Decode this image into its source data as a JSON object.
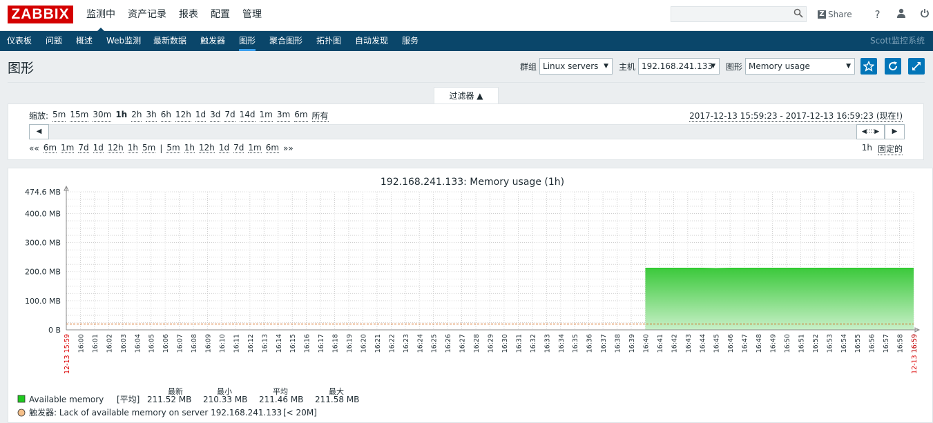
{
  "top": {
    "logo": "ZABBIX",
    "menu": [
      "监测中",
      "资产记录",
      "报表",
      "配置",
      "管理"
    ],
    "share_label": "Share",
    "icons": [
      "search-icon",
      "help-icon",
      "user-icon",
      "power-icon"
    ]
  },
  "nav": {
    "items": [
      "仪表板",
      "问题",
      "概述",
      "Web监测",
      "最新数据",
      "触发器",
      "图形",
      "聚合图形",
      "拓扑图",
      "自动发现",
      "服务"
    ],
    "active": "图形",
    "brand": "Scott监控系统"
  },
  "page": {
    "title": "图形",
    "group_label": "群组",
    "group_value": "Linux servers",
    "host_label": "主机",
    "host_value": "192.168.241.133",
    "graph_label": "图形",
    "graph_value": "Memory usage"
  },
  "filter": {
    "tab_label": "过滤器 ▲",
    "zoom_label": "缩放:",
    "zoom": [
      "5m",
      "15m",
      "30m",
      "1h",
      "2h",
      "3h",
      "6h",
      "12h",
      "1d",
      "3d",
      "7d",
      "14d",
      "1m",
      "3m",
      "6m",
      "所有"
    ],
    "zoom_active": "1h",
    "period": "2017-12-13 15:59:23 - 2017-12-13 16:59:23 (现在!)",
    "back_start": "««",
    "back": [
      "6m",
      "1m",
      "7d",
      "1d",
      "12h",
      "1h",
      "5m"
    ],
    "divider": "|",
    "fwd": [
      "5m",
      "1h",
      "12h",
      "1d",
      "7d",
      "1m",
      "6m"
    ],
    "fwd_end": "»»",
    "fixed_value": "1h",
    "fixed_label": "固定的"
  },
  "chart_data": {
    "type": "area",
    "title": "192.168.241.133: Memory usage (1h)",
    "y_ticks": [
      "0 B",
      "100.0 MB",
      "200.0 MB",
      "300.0 MB",
      "400.0 MB",
      "474.6 MB"
    ],
    "ylim": [
      0,
      474.6
    ],
    "x_start_label": "12-13 15:59",
    "x_end_label": "12-13 16:59",
    "x_ticks": [
      "16:00",
      "16:01",
      "16:02",
      "16:03",
      "16:04",
      "16:05",
      "16:06",
      "16:07",
      "16:08",
      "16:09",
      "16:10",
      "16:11",
      "16:12",
      "16:13",
      "16:14",
      "16:15",
      "16:16",
      "16:17",
      "16:18",
      "16:19",
      "16:20",
      "16:21",
      "16:22",
      "16:23",
      "16:24",
      "16:25",
      "16:26",
      "16:27",
      "16:28",
      "16:29",
      "16:30",
      "16:31",
      "16:32",
      "16:33",
      "16:34",
      "16:35",
      "16:36",
      "16:37",
      "16:38",
      "16:39",
      "16:40",
      "16:41",
      "16:42",
      "16:43",
      "16:44",
      "16:45",
      "16:46",
      "16:47",
      "16:48",
      "16:49",
      "16:50",
      "16:51",
      "16:52",
      "16:53",
      "16:54",
      "16:55",
      "16:56",
      "16:57",
      "16:58",
      "16:59"
    ],
    "series": [
      {
        "name": "Available memory",
        "color": "#1fc91f",
        "x": [
          "16:40",
          "16:41",
          "16:42",
          "16:43",
          "16:44",
          "16:45",
          "16:46",
          "16:47",
          "16:48",
          "16:49",
          "16:50",
          "16:51",
          "16:52",
          "16:53",
          "16:54",
          "16:55",
          "16:56",
          "16:57",
          "16:58",
          "16:59"
        ],
        "values": [
          211.5,
          211.5,
          211.5,
          211.5,
          211.5,
          210.3,
          211.5,
          211.5,
          211.5,
          211.5,
          211.5,
          211.5,
          211.5,
          211.5,
          211.5,
          211.5,
          211.5,
          211.5,
          211.5,
          211.6
        ]
      }
    ],
    "threshold": {
      "value": 20,
      "color": "#d2691e"
    },
    "legend": {
      "headers": [
        "最新",
        "最小",
        "平均",
        "最大"
      ],
      "series_row": {
        "name": "Available memory",
        "func": "[平均]",
        "values": [
          "211.52 MB",
          "210.33 MB",
          "211.46 MB",
          "211.58 MB"
        ]
      },
      "trigger_row": "触发器: Lack of available memory on server 192.168.241.133",
      "trigger_cond": "[< 20M]"
    }
  }
}
